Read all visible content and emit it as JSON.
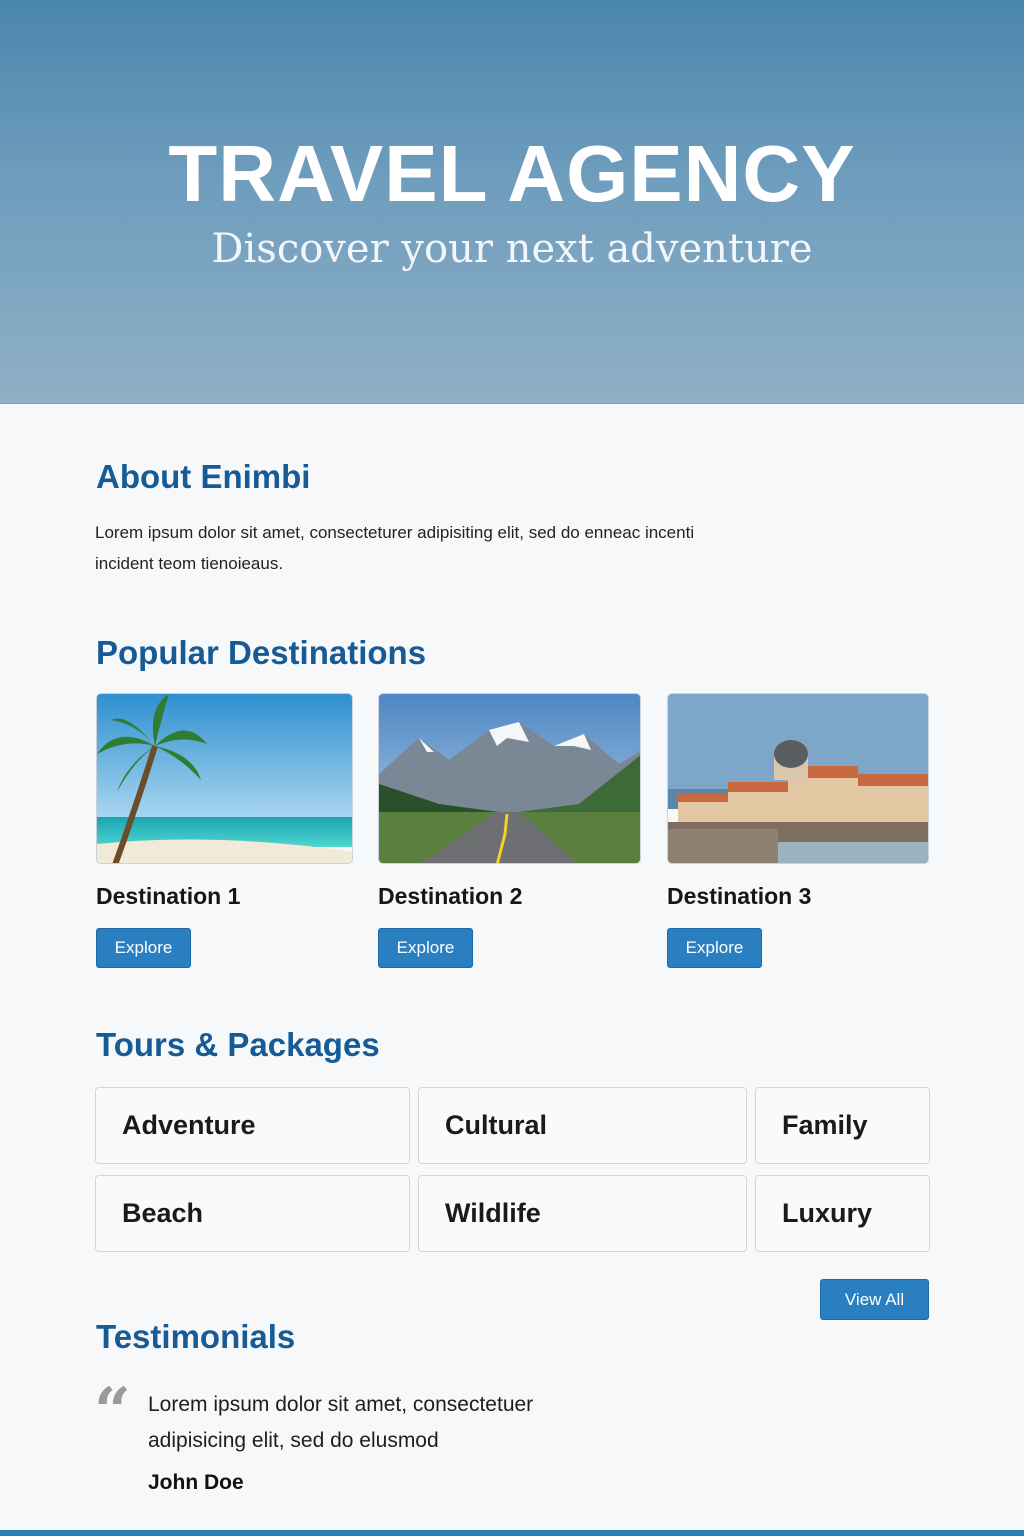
{
  "hero": {
    "title": "TRAVEL AGENCY",
    "subtitle": "Discover your next adventure"
  },
  "about": {
    "heading": "About Enimbi",
    "text": "Lorem ipsum dolor sit amet, consecteturer adipisiting elit, sed do enneac incenti incident teom tienoieaus."
  },
  "destinations": {
    "heading": "Popular Destinations",
    "items": [
      {
        "name": "Destination 1",
        "button": "Explore",
        "image": "tropical-beach-palm"
      },
      {
        "name": "Destination 2",
        "button": "Explore",
        "image": "mountain-road"
      },
      {
        "name": "Destination 3",
        "button": "Explore",
        "image": "coastal-old-town"
      }
    ]
  },
  "tours": {
    "heading": "Tours & Packages",
    "items": [
      "Adventure",
      "Cultural",
      "Family",
      "Beach",
      "Wildlife",
      "Luxury"
    ],
    "view_all": "View All"
  },
  "testimonials": {
    "heading": "Testimonials",
    "quote": "Lorem ipsum dolor sit amet, consectetuer adipisicing elit, sed do elusmod",
    "author": "John Doe",
    "quote_mark": "“"
  },
  "colors": {
    "accent": "#2a7fc0",
    "heading": "#165a96",
    "hero_top": "#4a86ad",
    "hero_bottom": "#8fb0c6"
  }
}
